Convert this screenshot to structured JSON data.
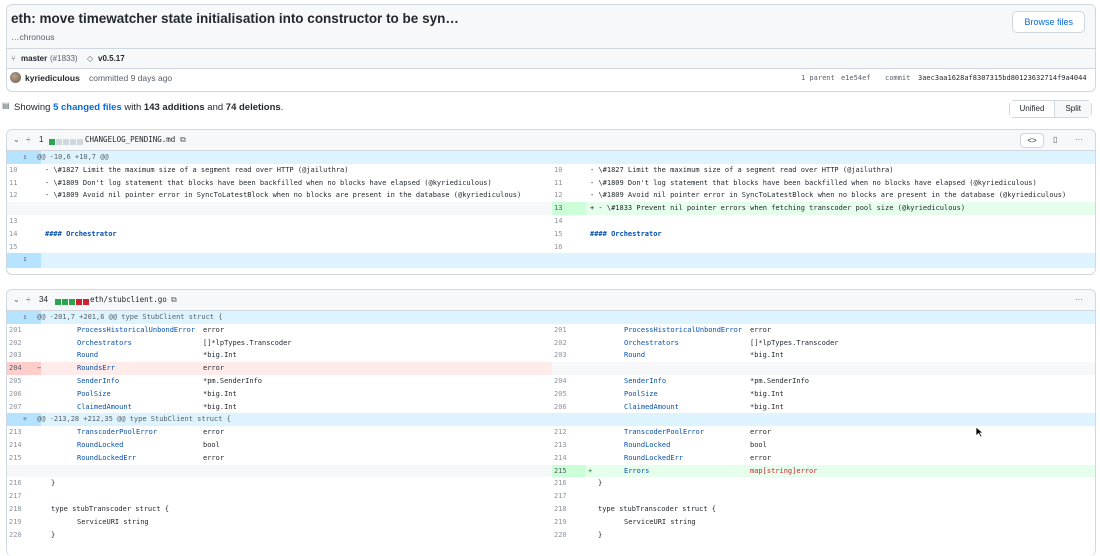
{
  "commit": {
    "title": "eth: move timewatcher state initialisation into constructor to be syn…",
    "title_continuation": "…chronous",
    "browse_label": "Browse files",
    "branch": "master",
    "pr": "(#1833)",
    "tag": "v0.5.17",
    "author": "kyriediculous",
    "action": "committed 9 days ago",
    "parent_label": "1 parent",
    "parent_sha": "e1e54ef",
    "commit_label": "commit",
    "commit_sha": "3aec3aa1628af8307315bd80123632714f9a4044"
  },
  "summary": {
    "pre": "Showing ",
    "link": "5 changed files",
    "mid": " with ",
    "adds": "143 additions",
    "and": " and ",
    "dels": "74 deletions",
    "end": ".",
    "unified": "Unified",
    "split": "Split"
  },
  "files": [
    {
      "count": "1",
      "name": "CHANGELOG_PENDING.md",
      "hunk": "@@ -10,6 +10,7 @@"
    },
    {
      "count": "34",
      "name": "eth/stubclient.go",
      "hunk1": "@@ -201,7 +201,6 @@ type StubClient struct {",
      "hunk2": "@@ -213,28 +212,35 @@ type StubClient struct {"
    }
  ],
  "diff1": [
    {
      "ln": "10",
      "lt": "- \\#1827 Limit the maximum size of a segment read over HTTP (@jailuthra)",
      "rn": "10",
      "rt": "- \\#1827 Limit the maximum size of a segment read over HTTP (@jailuthra)"
    },
    {
      "ln": "11",
      "lt": "- \\#1809 Don't log statement that blocks have been backfilled when no blocks have elapsed (@kyriediculous)",
      "rn": "11",
      "rt": "- \\#1809 Don't log statement that blocks have been backfilled when no blocks have elapsed (@kyriediculous)"
    },
    {
      "ln": "12",
      "lt": "- \\#1809 Avoid nil pointer error in SyncToLatestBlock when no blocks are present in the database (@kyriediculous)",
      "rn": "12",
      "rt": "- \\#1809 Avoid nil pointer error in SyncToLatestBlock when no blocks are present in the database (@kyriediculous)"
    },
    {
      "ln": "",
      "lt": "",
      "rn": "13",
      "rt": "+ - \\#1833 Prevent nil pointer errors when fetching transcoder pool size (@kyriediculous)"
    },
    {
      "ln": "13",
      "lt": "",
      "rn": "14",
      "rt": ""
    },
    {
      "ln": "14",
      "lt": "#### Orchestrator",
      "rn": "15",
      "rt": "#### Orchestrator"
    },
    {
      "ln": "15",
      "lt": "",
      "rn": "16",
      "rt": ""
    }
  ],
  "diff2a": [
    {
      "ln": "201",
      "lf": "ProcessHistoricalUnbondError",
      "lt": "error",
      "rn": "201",
      "rf": "ProcessHistoricalUnbondError",
      "rt": "error"
    },
    {
      "ln": "202",
      "lf": "Orchestrators",
      "lt": "[]*lpTypes.Transcoder",
      "rn": "202",
      "rf": "Orchestrators",
      "rt": "[]*lpTypes.Transcoder"
    },
    {
      "ln": "203",
      "lf": "Round",
      "lt": "*big.Int",
      "rn": "203",
      "rf": "Round",
      "rt": "*big.Int"
    },
    {
      "ln": "204",
      "lf": "RoundsErr",
      "lt": "error",
      "rn": "",
      "rf": "",
      "rt": ""
    },
    {
      "ln": "205",
      "lf": "SenderInfo",
      "lt": "*pm.SenderInfo",
      "rn": "204",
      "rf": "SenderInfo",
      "rt": "*pm.SenderInfo"
    },
    {
      "ln": "206",
      "lf": "PoolSize",
      "lt": "*big.Int",
      "rn": "205",
      "rf": "PoolSize",
      "rt": "*big.Int"
    },
    {
      "ln": "207",
      "lf": "ClaimedAmount",
      "lt": "*big.Int",
      "rn": "206",
      "rf": "ClaimedAmount",
      "rt": "*big.Int"
    }
  ],
  "diff2b": [
    {
      "ln": "213",
      "lf": "TranscoderPoolError",
      "lt": "error",
      "rn": "212",
      "rf": "TranscoderPoolError",
      "rt": "error"
    },
    {
      "ln": "214",
      "lf": "RoundLocked",
      "lt": "bool",
      "rn": "213",
      "rf": "RoundLocked",
      "rt": "bool"
    },
    {
      "ln": "215",
      "lf": "RoundLockedErr",
      "lt": "error",
      "rn": "214",
      "rf": "RoundLockedErr",
      "rt": "error"
    },
    {
      "ln": "",
      "lf": "",
      "lt": "",
      "rn": "215",
      "rf": "Errors",
      "rt": "map[string]error"
    },
    {
      "ln": "216",
      "lf": "}",
      "lt": "",
      "rn": "216",
      "rf": "}",
      "rt": ""
    },
    {
      "ln": "217",
      "lf": "",
      "lt": "",
      "rn": "217",
      "rf": "",
      "rt": ""
    },
    {
      "ln": "218",
      "lf": "type stubTranscoder struct {",
      "lt": "",
      "rn": "218",
      "rf": "type stubTranscoder struct {",
      "rt": ""
    },
    {
      "ln": "219",
      "lf": "ServiceURI string",
      "lt": "",
      "rn": "219",
      "rf": "ServiceURI string",
      "rt": ""
    },
    {
      "ln": "220",
      "lf": "}",
      "lt": "",
      "rn": "220",
      "rf": "}",
      "rt": ""
    }
  ]
}
